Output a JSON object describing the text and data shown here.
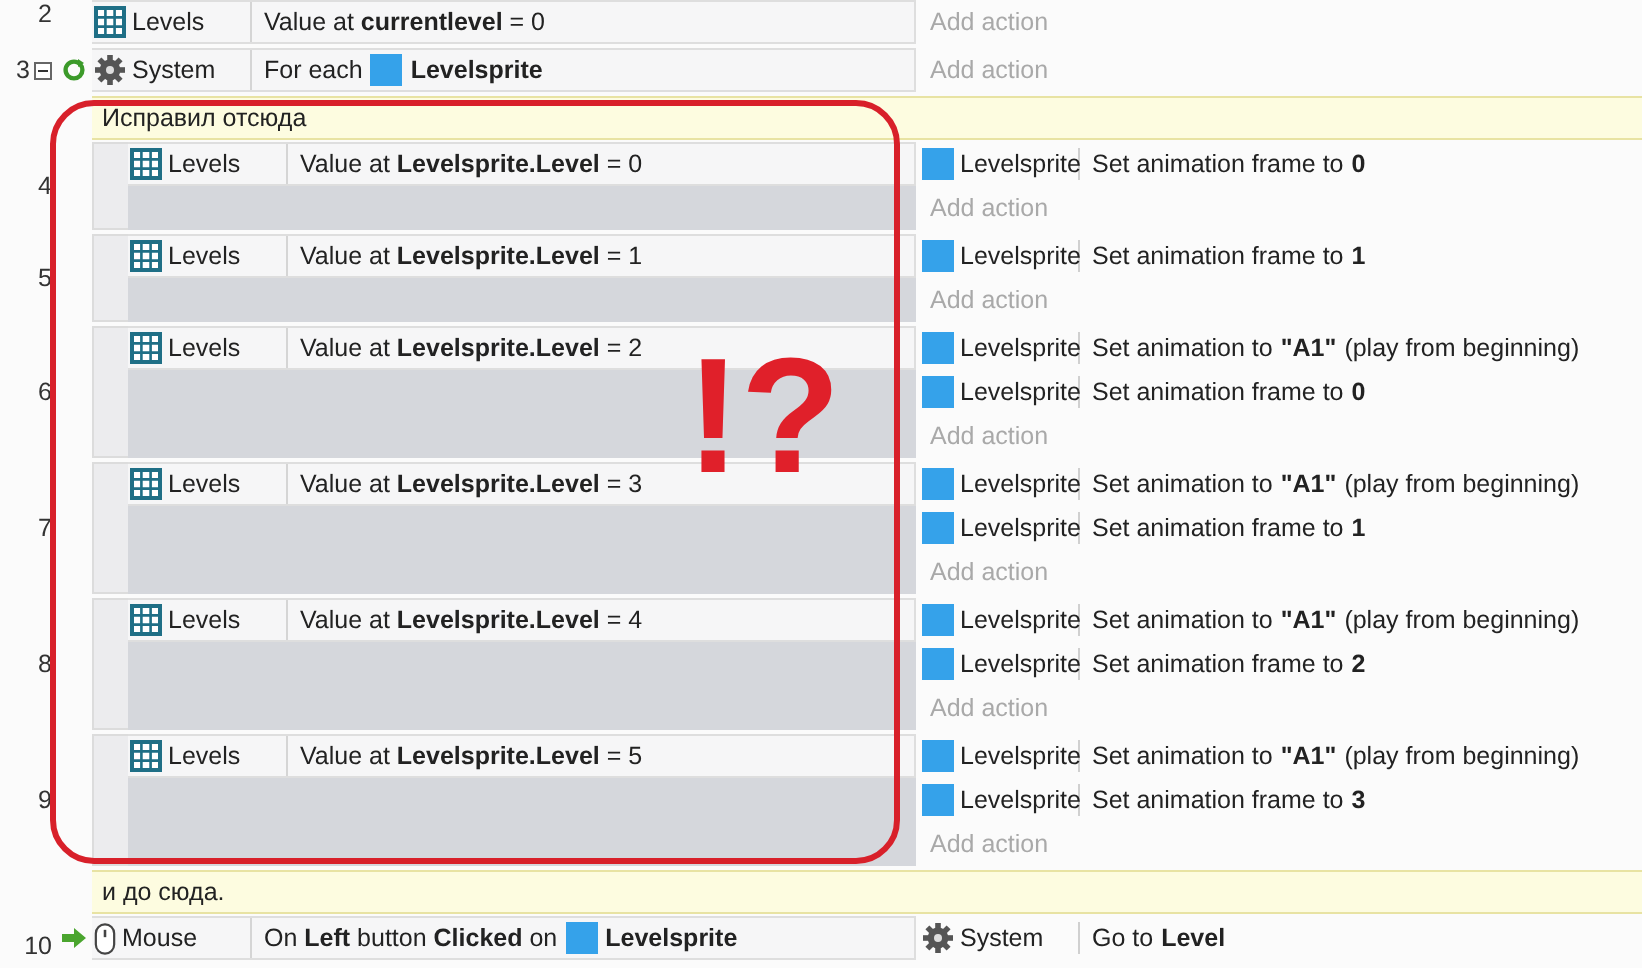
{
  "rows": [
    {
      "kind": "event",
      "number": "2",
      "conditions": [
        {
          "object": {
            "kind": "array",
            "name": "Levels"
          },
          "text": "Value at **currentlevel** = 0"
        }
      ],
      "actions": [],
      "add_action": "Add action"
    },
    {
      "kind": "event",
      "number": "3",
      "expanded": true,
      "conditions": [
        {
          "kind": "loop",
          "object": {
            "kind": "system",
            "name": "System"
          },
          "text": "For each",
          "tail_object": {
            "kind": "sprite",
            "name": "Levelsprite"
          }
        }
      ],
      "actions": [],
      "add_action": "Add action",
      "children": [
        {
          "kind": "comment",
          "text": "Исправил отсюда"
        },
        {
          "kind": "event",
          "number": "4",
          "conditions": [
            {
              "object": {
                "kind": "array",
                "name": "Levels"
              },
              "text": "Value at **Levelsprite.Level** = 0"
            }
          ],
          "actions": [
            {
              "object": {
                "kind": "sprite",
                "name": "Levelsprite"
              },
              "text": "Set animation frame to **0**"
            }
          ],
          "add_action": "Add action"
        },
        {
          "kind": "event",
          "number": "5",
          "conditions": [
            {
              "object": {
                "kind": "array",
                "name": "Levels"
              },
              "text": "Value at **Levelsprite.Level** = 1"
            }
          ],
          "actions": [
            {
              "object": {
                "kind": "sprite",
                "name": "Levelsprite"
              },
              "text": "Set animation frame to **1**"
            }
          ],
          "add_action": "Add action"
        },
        {
          "kind": "event",
          "number": "6",
          "conditions": [
            {
              "object": {
                "kind": "array",
                "name": "Levels"
              },
              "text": "Value at **Levelsprite.Level** = 2"
            }
          ],
          "actions": [
            {
              "object": {
                "kind": "sprite",
                "name": "Levelsprite"
              },
              "text": "Set animation to **\"A1\"** (play from beginning)"
            },
            {
              "object": {
                "kind": "sprite",
                "name": "Levelsprite"
              },
              "text": "Set animation frame to **0**"
            }
          ],
          "add_action": "Add action"
        },
        {
          "kind": "event",
          "number": "7",
          "conditions": [
            {
              "object": {
                "kind": "array",
                "name": "Levels"
              },
              "text": "Value at **Levelsprite.Level** = 3"
            }
          ],
          "actions": [
            {
              "object": {
                "kind": "sprite",
                "name": "Levelsprite"
              },
              "text": "Set animation to **\"A1\"** (play from beginning)"
            },
            {
              "object": {
                "kind": "sprite",
                "name": "Levelsprite"
              },
              "text": "Set animation frame to **1**"
            }
          ],
          "add_action": "Add action"
        },
        {
          "kind": "event",
          "number": "8",
          "conditions": [
            {
              "object": {
                "kind": "array",
                "name": "Levels"
              },
              "text": "Value at **Levelsprite.Level** = 4"
            }
          ],
          "actions": [
            {
              "object": {
                "kind": "sprite",
                "name": "Levelsprite"
              },
              "text": "Set animation to **\"A1\"** (play from beginning)"
            },
            {
              "object": {
                "kind": "sprite",
                "name": "Levelsprite"
              },
              "text": "Set animation frame to **2**"
            }
          ],
          "add_action": "Add action"
        },
        {
          "kind": "event",
          "number": "9",
          "conditions": [
            {
              "object": {
                "kind": "array",
                "name": "Levels"
              },
              "text": "Value at **Levelsprite.Level** = 5"
            }
          ],
          "actions": [
            {
              "object": {
                "kind": "sprite",
                "name": "Levelsprite"
              },
              "text": "Set animation to **\"A1\"** (play from beginning)"
            },
            {
              "object": {
                "kind": "sprite",
                "name": "Levelsprite"
              },
              "text": "Set animation frame to **3**"
            }
          ],
          "add_action": "Add action"
        },
        {
          "kind": "comment",
          "text": "и до сюда."
        }
      ]
    },
    {
      "kind": "event",
      "number": "10",
      "conditions": [
        {
          "kind": "trigger",
          "object": {
            "kind": "mouse",
            "name": "Mouse"
          },
          "text": "On **Left** button **Clicked** on",
          "tail_object": {
            "kind": "sprite",
            "name": "Levelsprite"
          }
        }
      ],
      "actions": [
        {
          "object": {
            "kind": "system",
            "name": "System"
          },
          "text": "Go to **Level**"
        }
      ]
    }
  ],
  "annotation": {
    "text": "!?"
  }
}
